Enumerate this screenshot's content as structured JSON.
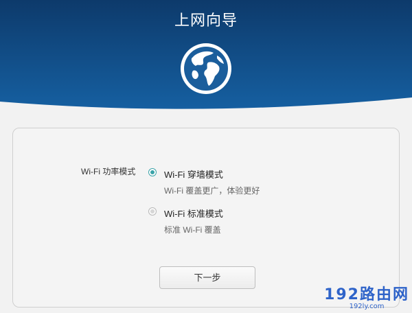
{
  "header": {
    "title": "上网向导"
  },
  "form": {
    "label": "Wi-Fi 功率模式",
    "options": [
      {
        "title": "Wi-Fi 穿墙模式",
        "desc": "Wi-Fi 覆盖更广，体验更好",
        "selected": true
      },
      {
        "title": "Wi-Fi 标准模式",
        "desc": "标准 Wi-Fi 覆盖",
        "selected": false
      }
    ],
    "next_label": "下一步"
  },
  "watermark": {
    "main": "192路由网",
    "sub": "192ly.com"
  },
  "colors": {
    "header_dark": "#0d3a6b",
    "header_light": "#1661a3",
    "radio_accent": "#3aa3a8",
    "watermark": "#2e63c9"
  },
  "icons": {
    "globe": "globe-icon"
  }
}
